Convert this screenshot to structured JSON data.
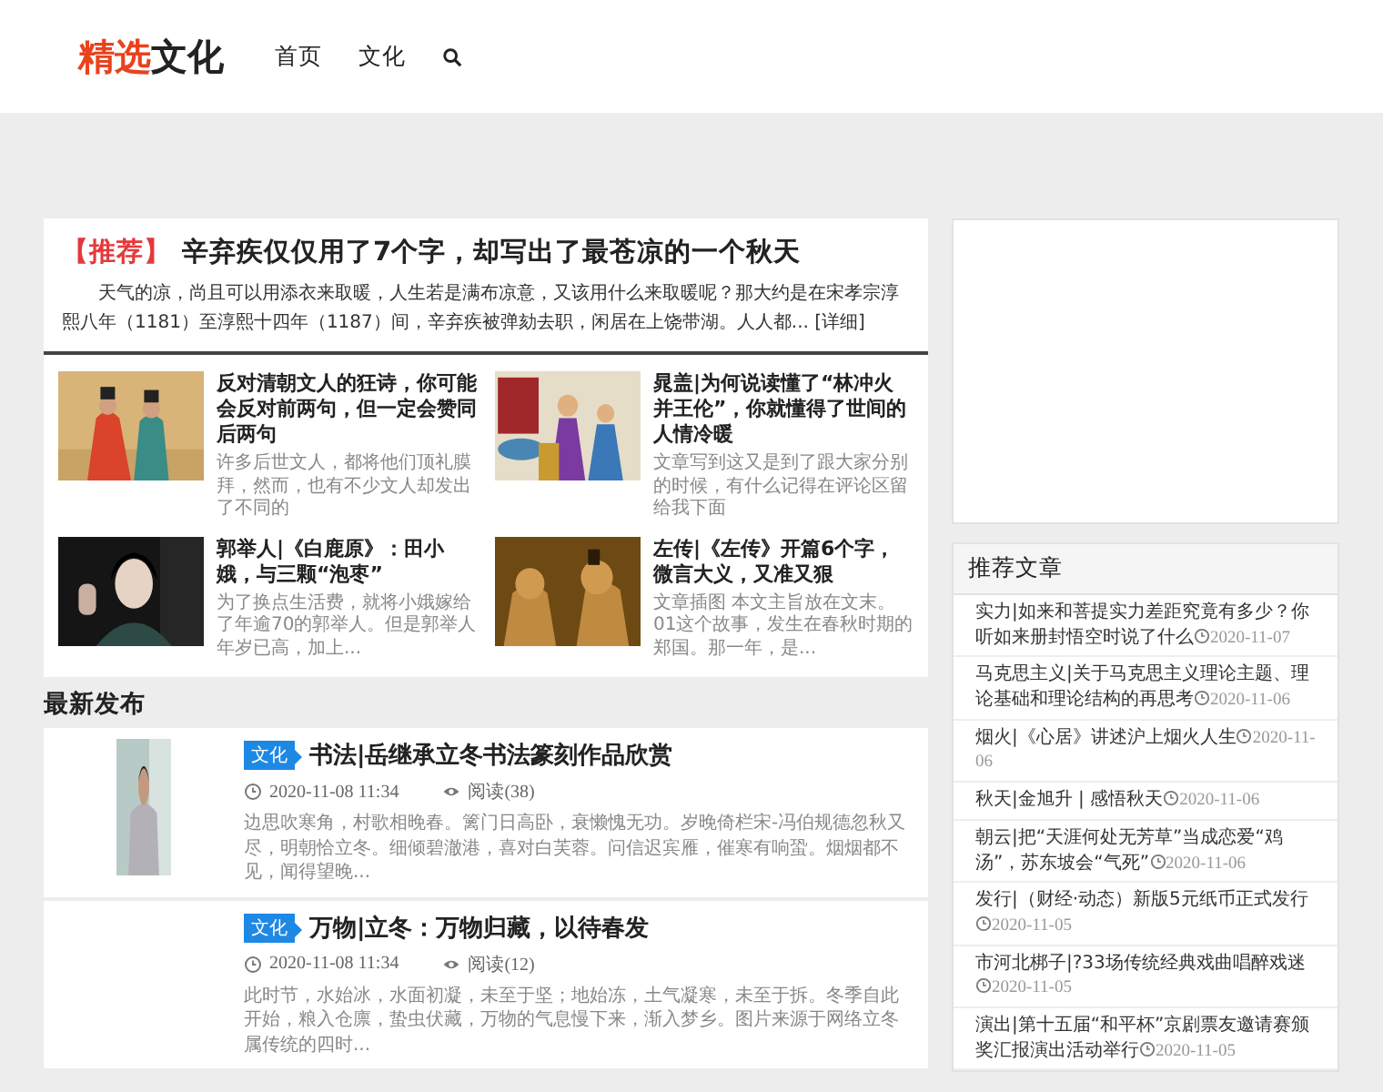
{
  "header": {
    "logo_accent": "精选",
    "logo_rest": "文化",
    "nav": [
      {
        "label": "首页"
      },
      {
        "label": "文化"
      }
    ]
  },
  "featured": {
    "tag": "【推荐】",
    "title": "辛弃疾仅仅用了7个字，却写出了最苍凉的一个秋天",
    "excerpt": "天气的凉，尚且可以用添衣来取暖，人生若是满布凉意，又该用什么来取暖呢？那大约是在宋孝宗淳熙八年（1181）至淳熙十四年（1187）间，辛弃疾被弹劾去职，闲居在上饶带湖。人人都...",
    "more": "[详细]"
  },
  "grid": [
    {
      "title": "反对清朝文人的狂诗，你可能会反对前两句，但一定会赞同后两句",
      "excerpt": "许多后世文人，都将他们顶礼膜拜，然而，也有不少文人却发出了不同的",
      "kind": "picture"
    },
    {
      "title": "晁盖|为何说读懂了“林冲火并王伦”，你就懂得了世间的人情冷暖",
      "excerpt": "文章写到这又是到了跟大家分别的时候，有什么记得在评论区留给我下面",
      "kind": "picture"
    },
    {
      "title": "郭举人|《白鹿原》：田小娥，与三颗“泡枣”",
      "excerpt": "为了换点生活费，就将小娥嫁给了年逾70的郭举人。但是郭举人年岁已高，加上...",
      "kind": "picture"
    },
    {
      "title": "左传|《左传》开篇6个字，微言大义，又准又狠",
      "excerpt": "文章插图 本文主旨放在文末。01这个故事，发生在春秋时期的郑国。那一年，是...",
      "kind": "picture"
    }
  ],
  "latest": {
    "heading": "最新发布",
    "items": [
      {
        "tag": "文化",
        "title": "书法|岳继承立冬书法篆刻作品欣赏",
        "date": "2020-11-08 11:34",
        "views": "阅读(38)",
        "excerpt": "边思吹寒角，村歌相晚春。篱门日高卧，衰懒愧无功。岁晚倚栏宋-冯伯规德忽秋又尽，明朝恰立冬。细倾碧澈港，喜对白芙蓉。问信迟宾雁，催寒有响蛩。烟烟都不见，闻得望晚...",
        "picture": true
      },
      {
        "tag": "文化",
        "title": "万物|立冬：万物归藏，以待春发",
        "date": "2020-11-08 11:34",
        "views": "阅读(12)",
        "excerpt": "此时节，水始冰，水面初凝，未至于坚；地始冻，土气凝寒，未至于拆。冬季自此开始，粮入仓廪，蛰虫伏藏，万物的气息慢下来，渐入梦乡。图片来源于网络立冬属传统的四时...",
        "picture": false
      }
    ]
  },
  "sidebar": {
    "heading": "推荐文章",
    "items": [
      {
        "title": "实力|如来和菩提实力差距究竟有多少？你听如来册封悟空时说了什么",
        "date": "2020-11-07"
      },
      {
        "title": "马克思主义|关于马克思主义理论主题、理论基础和理论结构的再思考",
        "date": "2020-11-06"
      },
      {
        "title": "烟火|《心居》讲述沪上烟火人生",
        "date": "2020-11-06"
      },
      {
        "title": "秋天|金旭升 | 感悟秋天",
        "date": "2020-11-06"
      },
      {
        "title": "朝云|把“天涯何处无芳草”当成恋爱“鸡汤”，苏东坡会“气死”",
        "date": "2020-11-06"
      },
      {
        "title": "发行|（财经·动态）新版5元纸币正式发行",
        "date": "2020-11-05"
      },
      {
        "title": "市河北梆子|?33场传统经典戏曲唱醉戏迷",
        "date": "2020-11-05"
      },
      {
        "title": "演出|第十五届“和平杯”京剧票友邀请赛颁奖汇报演出活动举行",
        "date": "2020-11-05"
      }
    ]
  }
}
